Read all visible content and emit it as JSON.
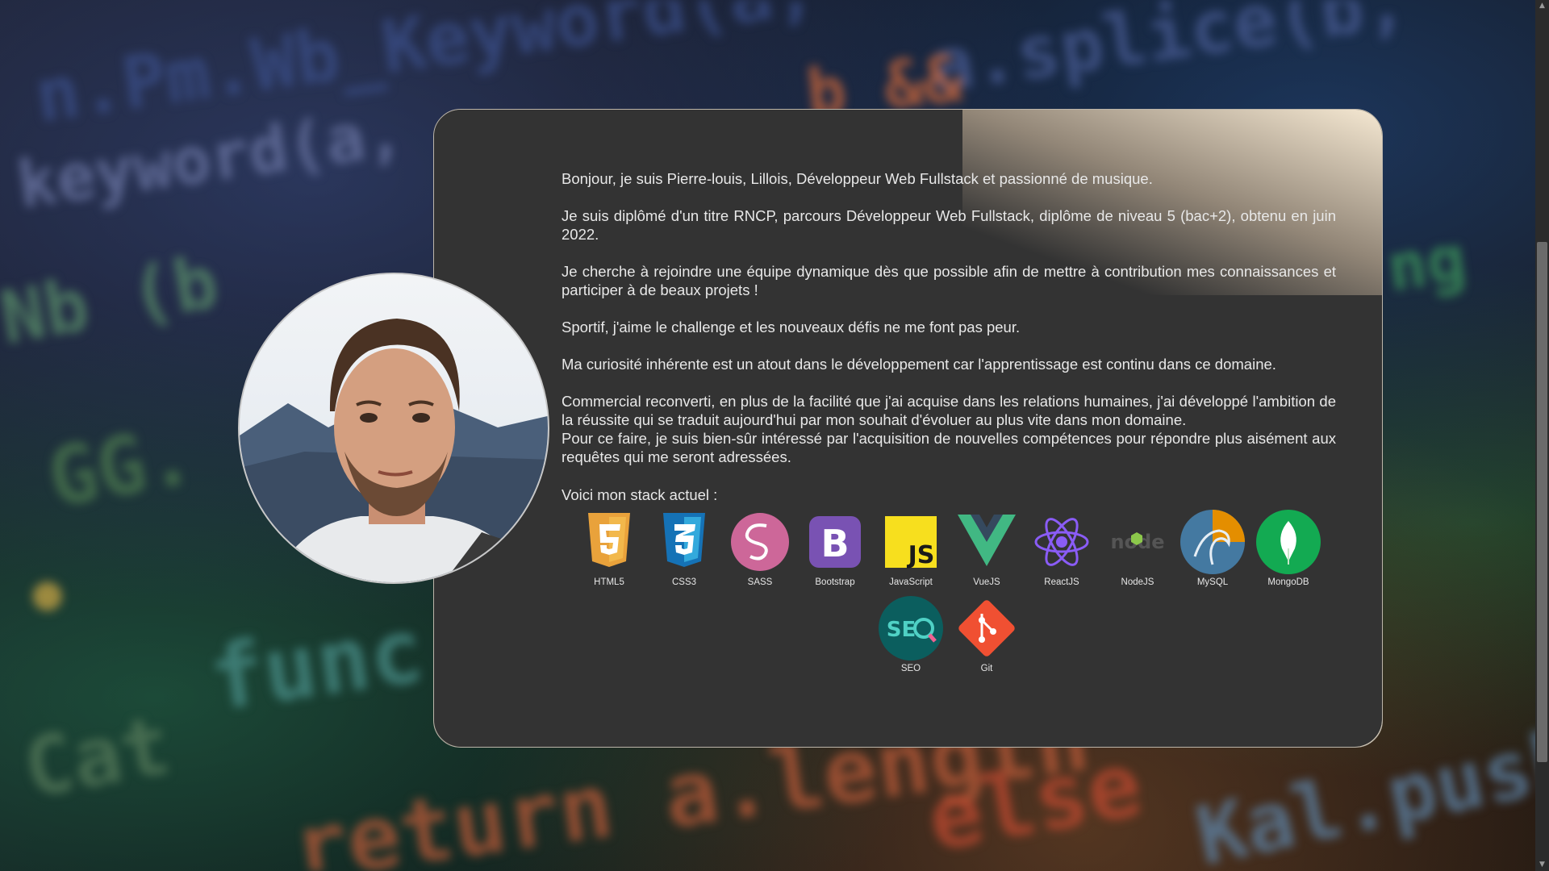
{
  "profile": {
    "avatar_alt": "Pierre-louis"
  },
  "about": {
    "paragraphs": [
      "Bonjour, je suis Pierre-louis, Lillois, Développeur Web Fullstack et passionné de musique.",
      "Je suis diplômé d'un titre RNCP, parcours Développeur Web Fullstack, diplôme de niveau 5 (bac+2), obtenu en juin 2022.",
      "Je cherche à rejoindre une équipe dynamique dès que possible afin de mettre à contribution mes connaissances et participer à de beaux projets !",
      "Sportif, j'aime le challenge et les nouveaux défis ne me font pas peur.",
      "Ma curiosité inhérente est un atout dans le développement car l'apprentissage est continu dans ce domaine.",
      "Commercial reconverti, en plus de la facilité que j'ai acquise dans les relations humaines, j'ai développé l'ambition de la réussite qui se traduit aujourd'hui par mon souhait d'évoluer au plus vite dans mon domaine.",
      "Pour ce faire, je suis bien-sûr intéressé par l'acquisition de nouvelles compétences pour répondre plus aisément aux requêtes qui me seront adressées."
    ],
    "stack_title": "Voici mon stack actuel :"
  },
  "stack": [
    {
      "label": "HTML5",
      "icon": "html5-icon",
      "color": "#e44d26"
    },
    {
      "label": "CSS3",
      "icon": "css3-icon",
      "color": "#1572b6"
    },
    {
      "label": "SASS",
      "icon": "sass-icon",
      "color": "#cd6799"
    },
    {
      "label": "Bootstrap",
      "icon": "bootstrap-icon",
      "color": "#7952b3"
    },
    {
      "label": "JavaScript",
      "icon": "javascript-icon",
      "color": "#f7df1e"
    },
    {
      "label": "VueJS",
      "icon": "vuejs-icon",
      "color": "#41b883"
    },
    {
      "label": "ReactJS",
      "icon": "react-icon",
      "color": "#8a5cf6"
    },
    {
      "label": "NodeJS",
      "icon": "nodejs-icon",
      "color": "#8cc84b"
    },
    {
      "label": "MySQL",
      "icon": "mysql-icon",
      "color": "#4479a1"
    },
    {
      "label": "MongoDB",
      "icon": "mongodb-icon",
      "color": "#13aa52"
    },
    {
      "label": "SEO",
      "icon": "seo-icon",
      "color": "#0e7a7a"
    },
    {
      "label": "Git",
      "icon": "git-icon",
      "color": "#f05032"
    }
  ]
}
